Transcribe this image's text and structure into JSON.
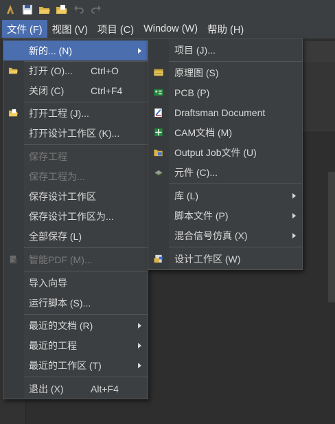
{
  "toolbar": {
    "buttons": [
      {
        "name": "altium-logo-icon"
      },
      {
        "name": "save-icon"
      },
      {
        "name": "open-folder-icon"
      },
      {
        "name": "open-project-icon"
      },
      {
        "name": "undo-icon"
      },
      {
        "name": "redo-icon"
      }
    ]
  },
  "menubar": [
    {
      "label": "文件 (F)",
      "active": true
    },
    {
      "label": "视图 (V)"
    },
    {
      "label": "项目 (C)"
    },
    {
      "label": "Window (W)"
    },
    {
      "label": "帮助 (H)"
    }
  ],
  "file_menu": {
    "items": [
      {
        "label": "新的... (N)",
        "shortcut": "",
        "submenu": true,
        "highlight": true
      },
      {
        "label": "打开 (O)...",
        "shortcut": "Ctrl+O",
        "icon": "open-folder-icon"
      },
      {
        "label": "关闭 (C)",
        "shortcut": "Ctrl+F4"
      },
      {
        "label": "打开工程 (J)...",
        "shortcut": "",
        "icon": "open-project-icon"
      },
      {
        "label": "打开设计工作区 (K)...",
        "shortcut": ""
      },
      {
        "label": "保存工程",
        "shortcut": "",
        "disabled": true
      },
      {
        "label": "保存工程为...",
        "shortcut": "",
        "disabled": true
      },
      {
        "label": "保存设计工作区",
        "shortcut": ""
      },
      {
        "label": "保存设计工作区为...",
        "shortcut": ""
      },
      {
        "label": "全部保存 (L)",
        "shortcut": ""
      },
      {
        "label": "智能PDF (M)...",
        "shortcut": "",
        "disabled": true,
        "icon": "smart-pdf-icon"
      },
      {
        "label": "导入向导",
        "shortcut": ""
      },
      {
        "label": "运行脚本 (S)...",
        "shortcut": ""
      },
      {
        "label": "最近的文档 (R)",
        "shortcut": "",
        "submenu": true
      },
      {
        "label": "最近的工程",
        "shortcut": "",
        "submenu": true
      },
      {
        "label": "最近的工作区 (T)",
        "shortcut": "",
        "submenu": true
      },
      {
        "label": "退出 (X)",
        "shortcut": "Alt+F4"
      }
    ]
  },
  "new_submenu": {
    "items": [
      {
        "label": "项目 (J)..."
      },
      {
        "label": "原理图 (S)",
        "icon": "schematic-icon"
      },
      {
        "label": "PCB (P)",
        "icon": "pcb-icon"
      },
      {
        "label": "Draftsman Document",
        "icon": "draftsman-icon"
      },
      {
        "label": "CAM文档 (M)",
        "icon": "cam-icon"
      },
      {
        "label": "Output Job文件 (U)",
        "icon": "output-job-icon"
      },
      {
        "label": "元件 (C)...",
        "icon": "component-icon"
      },
      {
        "label": "库 (L)",
        "submenu": true
      },
      {
        "label": "脚本文件 (P)",
        "submenu": true
      },
      {
        "label": "混合信号仿真 (X)",
        "submenu": true
      },
      {
        "label": "设计工作区 (W)",
        "icon": "workspace-icon"
      }
    ]
  },
  "colors": {
    "menu_bg": "#3c3f41",
    "highlight": "#4b6eaf",
    "text": "#d8d8d8",
    "disabled_text": "#7a7a7a"
  }
}
